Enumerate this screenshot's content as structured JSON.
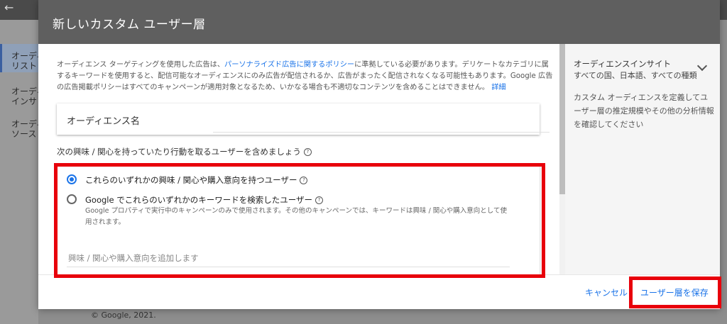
{
  "background": {
    "back_arrow": "←",
    "sidebar_items": [
      "オーディ\nリスト",
      "オーディ\nインサ",
      "オーディ\nソース"
    ],
    "footer": "© Google, 2021."
  },
  "dialog": {
    "title": "新しいカスタム ユーザー層",
    "intro_part1": "オーディエンス ターゲティングを使用した広告は、",
    "intro_link": "パーソナライズド広告に関するポリシー",
    "intro_part2": "に準拠している必要があります。デリケートなカテゴリに属するキーワードを使用すると、配信可能なオーディエンスにのみ広告が配信されるか、広告がまったく配信されなくなる可能性もあります。Google 広告の広告掲載ポリシーはすべてのキャンペーンが適用対象となるため、いかなる場合も不適切なコンテンツを含めることはできません。",
    "intro_more": "詳細",
    "audience_name_label": "オーディエンス名",
    "audience_name_value": "",
    "include_prompt": "次の興味 / 関心を持っていたり行動を取るユーザーを含めましょう",
    "option1_label": "これらのいずれかの興味 / 関心や購入意向を持つユーザー",
    "option2_label": "Google でこれらのいずれかのキーワードを検索したユーザー",
    "option2_sub": "Google プロパティで実行中のキャンペーンのみで使用されます。その他のキャンペーンでは、キーワードは興味 / 関心や購入意向として使用されます。",
    "interest_placeholder": "興味 / 関心や購入意向を追加します",
    "selected_option": 1,
    "help_glyph": "?",
    "insights": {
      "title": "オーディエンスインサイト",
      "subtitle": "すべての国、日本語、すべての種類",
      "body": "カスタム オーディエンスを定義してユーザー層の推定規模やその他の分析情報を確認してください"
    },
    "cancel_label": "キャンセル",
    "save_label": "ユーザー層を保存"
  },
  "colors": {
    "accent": "#1a73e8",
    "highlight": "#e8000b",
    "header": "#5f5f5f"
  }
}
